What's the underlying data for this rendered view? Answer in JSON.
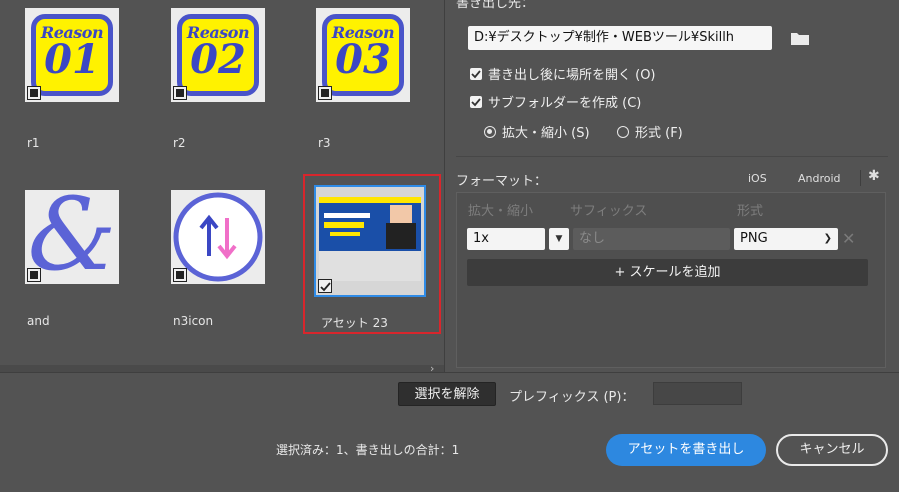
{
  "assets": [
    {
      "label": "r1",
      "reason_word": "Reason",
      "reason_num": "01"
    },
    {
      "label": "r2",
      "reason_word": "Reason",
      "reason_num": "02"
    },
    {
      "label": "r3",
      "reason_word": "Reason",
      "reason_num": "03"
    },
    {
      "label": "and",
      "glyph": "&"
    },
    {
      "label": "n3icon"
    },
    {
      "label": "アセット 23",
      "selected": true
    }
  ],
  "export_to": {
    "heading": "書き出し先：",
    "path": "D:¥デスクトップ¥制作・WEBツール¥Skillh"
  },
  "options": {
    "open_after": "書き出し後に場所を開く (O)",
    "create_subfolders": "サブフォルダーを作成 (C)",
    "scale_radio": "拡大・縮小 (S)",
    "format_radio": "形式 (F)"
  },
  "format": {
    "heading": "フォーマット：",
    "ios": "iOS",
    "android": "Android",
    "col_scale": "拡大・縮小",
    "col_suffix": "サフィックス",
    "col_format": "形式",
    "scale_value": "1x",
    "suffix_placeholder": "なし",
    "format_value": "PNG",
    "add_scale": "+ スケールを追加"
  },
  "bottom": {
    "deselect": "選択を解除",
    "prefix_label": "プレフィックス (P)：",
    "summary": "選択済み：1、書き出しの合計：1",
    "export_button": "アセットを書き出し",
    "cancel_button": "キャンセル"
  },
  "colors": {
    "accent": "#2d88e0",
    "reason_yellow": "#fff200",
    "reason_blue": "#3b47c4",
    "selection_red": "#d8262c"
  }
}
